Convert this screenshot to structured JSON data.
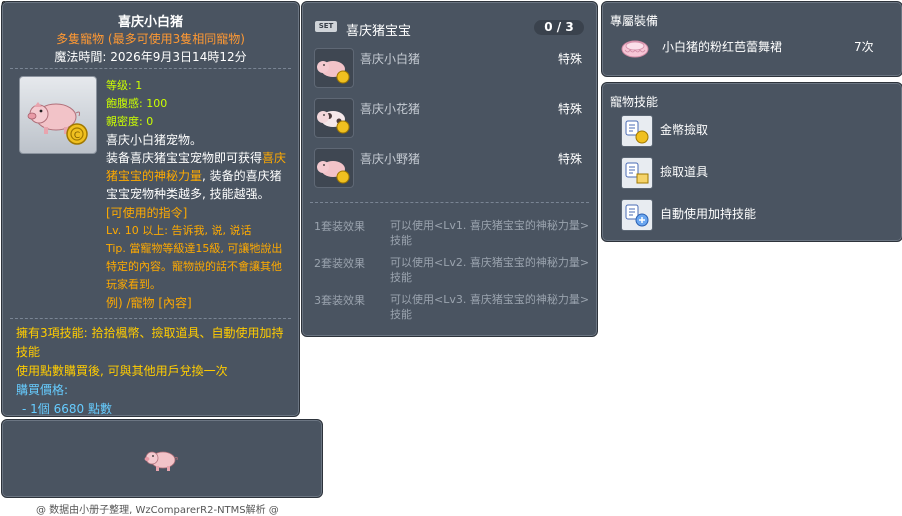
{
  "item_id": "05000997",
  "main": {
    "title": "喜庆小白猪",
    "subtitle": "多隻寵物 (最多可使用3隻相同寵物)",
    "expiry": "魔法時間: 2026年9月3日14時12分",
    "stats": {
      "level": "等级: 1",
      "fullness": "飽腹感: 100",
      "closeness": "親密度: 0"
    },
    "desc": {
      "line1": "喜庆小白猪宠物。",
      "line2a": "装备喜庆猪宝宝宠物即可获得",
      "line2b": "喜庆猪宝宝的神秘力量",
      "line2c": ", 装备的喜庆猪宝宝宠物种类越多, 技能越强。",
      "cmd_header": "[可使用的指令]",
      "cmd_lv": "Lv. 10 以上: 告诉我, 说, 说话",
      "tip": "Tip. 當寵物等級達15級, 可讓牠說出特定的內容。寵物說的話不會讓其他玩家看到。",
      "example": "例) /寵物 [內容]"
    },
    "skills_line": "擁有3項技能: 拾拾楓幣、撿取道具、自動使用加持技能",
    "trade_line": "使用點數購買後, 可與其他用戶兌換一次",
    "price_label": "購買價格:",
    "price_value": "- 1個 6680 點數"
  },
  "footer": "@ 数据由小册子整理, WzComparerR2-NTMS解析 @",
  "set": {
    "badge": "SET",
    "name": "喜庆猪宝宝",
    "count": "0 / 3",
    "items": [
      {
        "name": "喜庆小白猪",
        "type": "特殊"
      },
      {
        "name": "喜庆小花猪",
        "type": "特殊"
      },
      {
        "name": "喜庆小野猪",
        "type": "特殊"
      }
    ],
    "effects": [
      {
        "label": "1套装效果",
        "text": "可以使用<Lv1. 喜庆猪宝宝的神秘力量>技能"
      },
      {
        "label": "2套装效果",
        "text": "可以使用<Lv2. 喜庆猪宝宝的神秘力量>技能"
      },
      {
        "label": "3套装效果",
        "text": "可以使用<Lv3. 喜庆猪宝宝的神秘力量>技能"
      }
    ]
  },
  "exclusive": {
    "title": "專屬裝備",
    "item_name": "小白猪的粉红芭蕾舞裙",
    "item_count": "7次"
  },
  "skills": {
    "title": "寵物技能",
    "list": [
      "金幣撿取",
      "撿取道具",
      "自動使用加持技能"
    ]
  },
  "colors": {
    "panel_bg": "#4a5461",
    "accent_orange": "#ff9933",
    "stat_green": "#ccff00",
    "price_blue": "#66ccff"
  }
}
